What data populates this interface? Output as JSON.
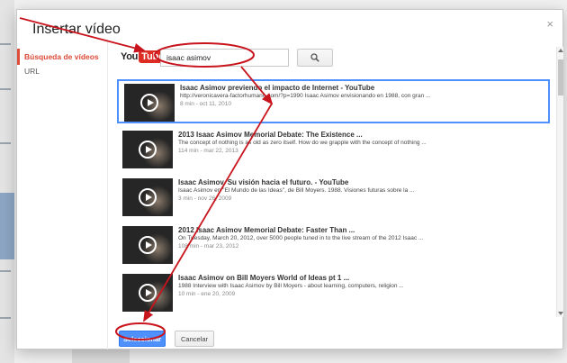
{
  "dialog": {
    "title": "Insertar vídeo",
    "close_glyph": "×"
  },
  "sidebar": {
    "items": [
      {
        "label": "Búsqueda de vídeos",
        "active": true
      },
      {
        "label": "URL",
        "active": false
      }
    ]
  },
  "search": {
    "logo_you": "You",
    "logo_tube": "Tube",
    "query": "isaac asimov",
    "button_icon": "search-icon"
  },
  "results": [
    {
      "title": "Isaac Asimov previendo el impacto de Internet - YouTube",
      "description": "http://veronicavera-factorhumano.com/?p=1990 Isaac Asimov envisionando en 1988, con gran ...",
      "meta": "8 min - oct 11, 2010",
      "selected": true
    },
    {
      "title": "2013 Isaac Asimov Memorial Debate: The Existence ...",
      "description": "The concept of nothing is as old as zero itself. How do we grapple with the concept of nothing ...",
      "meta": "114 min - mar 22, 2013",
      "selected": false
    },
    {
      "title": "Isaac Asimov. Su visión hacia el futuro. - YouTube",
      "description": "Isaac Asimov en \"El Mundo de las Ideas\", de Bill Moyers. 1988. Visiones futuras sobre la ...",
      "meta": "3 min - nov 26, 2009",
      "selected": false
    },
    {
      "title": "2012 Isaac Asimov Memorial Debate: Faster Than ...",
      "description": "On Tuesday, March 20, 2012, over 5000 people tuned in to the live stream of the 2012 Isaac ...",
      "meta": "108 min - mar 23, 2012",
      "selected": false
    },
    {
      "title": "Isaac Asimov on Bill Moyers World of Ideas pt 1 ...",
      "description": "1988 Interview with Isaac Asimov by Bill Moyers - about learning, computers, religion ...",
      "meta": "10 min - ene 20, 2009",
      "selected": false
    }
  ],
  "footer": {
    "select_label": "Seleccionar",
    "cancel_label": "Cancelar"
  },
  "colors": {
    "accent": "#4d90fe",
    "active_tab": "#dd4b39",
    "annotation": "#c8141c"
  }
}
